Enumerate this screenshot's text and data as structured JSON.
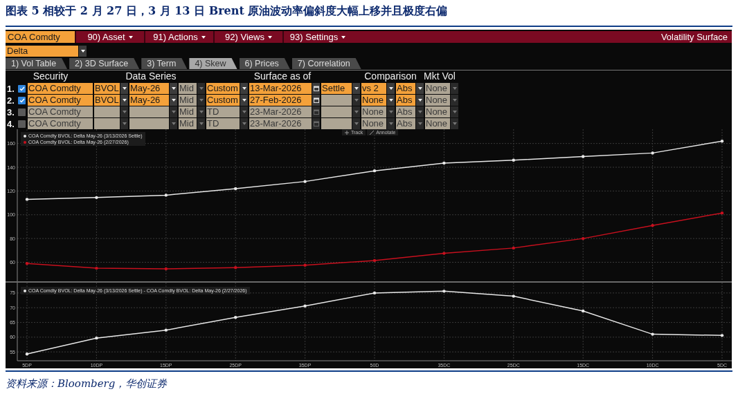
{
  "figure_title": "图表 5 相较于 2 月 27 日，3 月 13 日 Brent 原油波动率偏斜度大幅上移并且极度右偏",
  "terminal": {
    "menu_bar": {
      "security": "COA Comdty",
      "items": [
        "90) Asset",
        "91) Actions",
        "92) Views",
        "93) Settings"
      ],
      "function_title": "Volatility Surface"
    },
    "mode_dropdown": "Delta",
    "tabs": [
      {
        "label": "1) Vol Table",
        "selected": false
      },
      {
        "label": "2) 3D Surface",
        "selected": false
      },
      {
        "label": "3) Term",
        "selected": false
      },
      {
        "label": "4) Skew",
        "selected": true
      },
      {
        "label": "6) Prices",
        "selected": false
      },
      {
        "label": "7) Correlation",
        "selected": false
      }
    ],
    "form": {
      "headers": [
        "Security",
        "Data Series",
        "Surface as of",
        "Comparison",
        "Mkt Vol"
      ],
      "rows": [
        {
          "number": "1.",
          "checked": true,
          "cells": [
            {
              "kind": "text",
              "value": "COA Comdty",
              "active": true
            },
            {
              "kind": "dropdown",
              "value": "BVOL",
              "active": true
            },
            {
              "kind": "dropdown",
              "value": "May-26",
              "active": true
            },
            {
              "kind": "dropdown",
              "value": "Mid",
              "active": false
            },
            {
              "kind": "dropdown",
              "value": "Custom",
              "active": true
            },
            {
              "kind": "date",
              "value": "13-Mar-2026",
              "active": true
            },
            {
              "kind": "dropdown",
              "value": "Settle",
              "active": true
            },
            {
              "kind": "dropdown",
              "value": "vs 2",
              "active": true
            },
            {
              "kind": "dropdown",
              "value": "Abs",
              "active": true
            },
            {
              "kind": "dropdown",
              "value": "None",
              "active": false
            }
          ]
        },
        {
          "number": "2.",
          "checked": true,
          "cells": [
            {
              "kind": "text",
              "value": "COA Comdty",
              "active": true
            },
            {
              "kind": "dropdown",
              "value": "BVOL",
              "active": true
            },
            {
              "kind": "dropdown",
              "value": "May-26",
              "active": true
            },
            {
              "kind": "dropdown",
              "value": "Mid",
              "active": false
            },
            {
              "kind": "dropdown",
              "value": "Custom",
              "active": true
            },
            {
              "kind": "date",
              "value": "27-Feb-2026",
              "active": true
            },
            {
              "kind": "dropdown",
              "active": false
            },
            {
              "kind": "dropdown",
              "value": "None",
              "active": true
            },
            {
              "kind": "dropdown",
              "value": "Abs",
              "active": true
            },
            {
              "kind": "dropdown",
              "value": "None",
              "active": false
            }
          ]
        },
        {
          "number": "3.",
          "checked": false,
          "cells": [
            {
              "kind": "text",
              "value": "COA Comdty",
              "active": false
            },
            {
              "kind": "dropdown",
              "active": false
            },
            {
              "kind": "dropdown",
              "active": false
            },
            {
              "kind": "dropdown",
              "value": "Mid",
              "active": false
            },
            {
              "kind": "dropdown",
              "value": "TD",
              "active": false
            },
            {
              "kind": "date",
              "value": "23-Mar-2026",
              "active": false
            },
            {
              "kind": "dropdown",
              "active": false
            },
            {
              "kind": "dropdown",
              "value": "None",
              "active": false
            },
            {
              "kind": "dropdown",
              "value": "Abs",
              "active": false
            },
            {
              "kind": "dropdown",
              "value": "None",
              "active": false
            }
          ]
        },
        {
          "number": "4.",
          "checked": false,
          "cells": [
            {
              "kind": "text",
              "value": "COA Comdty",
              "active": false
            },
            {
              "kind": "dropdown",
              "active": false
            },
            {
              "kind": "dropdown",
              "active": false
            },
            {
              "kind": "dropdown",
              "value": "Mid",
              "active": false
            },
            {
              "kind": "dropdown",
              "value": "TD",
              "active": false
            },
            {
              "kind": "date",
              "value": "23-Mar-2026",
              "active": false
            },
            {
              "kind": "dropdown",
              "active": false
            },
            {
              "kind": "dropdown",
              "value": "None",
              "active": false
            },
            {
              "kind": "dropdown",
              "value": "Abs",
              "active": false
            },
            {
              "kind": "dropdown",
              "value": "None",
              "active": false
            }
          ]
        }
      ]
    },
    "chart_tools": [
      "Track",
      "Annotate"
    ],
    "charts": [
      {
        "chart_data": {
          "type": "line",
          "ylim": [
            44,
            172
          ],
          "grid": true,
          "yticks": [
            60,
            80,
            100,
            120,
            140,
            160
          ],
          "series": [
            {
              "name": "COA Comdty BVOL: Delta May-26 (3/13/2026 Settle)",
              "color": "#e8e8e8",
              "values": [
                113,
                114.5,
                116.5,
                122,
                128,
                137,
                143.5,
                146,
                149,
                152,
                162
              ]
            },
            {
              "name": "COA Comdty BVOL: Delta May-26 (2/27/2026)",
              "color": "#c8101e",
              "values": [
                59,
                55,
                54.5,
                55.5,
                57.5,
                61.5,
                67.5,
                72,
                80,
                91,
                101.5
              ]
            }
          ]
        }
      },
      {
        "chart_data": {
          "type": "line",
          "categories": [
            "5DP",
            "10DP",
            "15DP",
            "25DP",
            "35DP",
            "50D",
            "35DC",
            "25DC",
            "15DC",
            "10DC",
            "5DC"
          ],
          "ylim": [
            52,
            78.5
          ],
          "grid": true,
          "yticks": [
            55,
            60,
            65,
            70,
            75
          ],
          "series": [
            {
              "name": "COA Comdty BVOL: Delta May-26 (3/13/2026 Settle) - COA Comdty BVOL: Delta May-26 (2/27/2026)",
              "color": "#e8e8e8",
              "values": [
                54.3,
                59.7,
                62.4,
                66.7,
                70.6,
                75,
                75.6,
                73.9,
                68.9,
                61,
                60.6
              ]
            }
          ]
        }
      }
    ]
  },
  "source": "资料来源：Bloomberg，华创证券"
}
